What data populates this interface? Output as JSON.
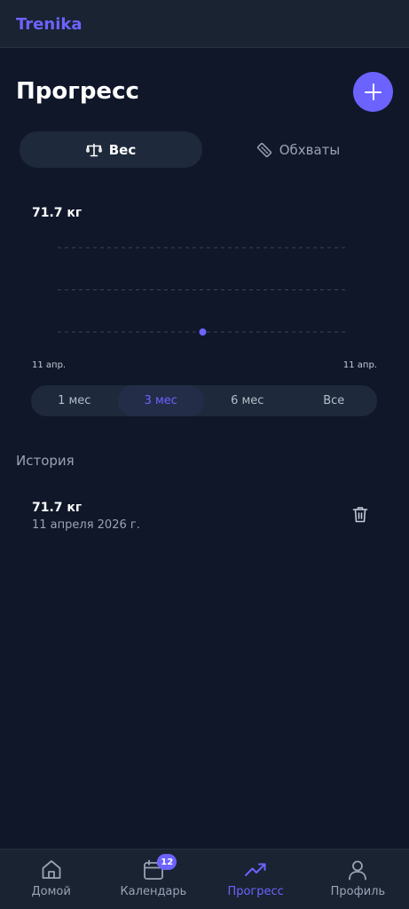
{
  "app": {
    "brand": "Trenika"
  },
  "header": {
    "title": "Прогресс",
    "add_icon": "plus-icon"
  },
  "colors": {
    "accent": "#6c63ff",
    "background": "#0f1729",
    "surface": "#1e293b"
  },
  "tabs": [
    {
      "label": "Вес",
      "icon": "scale-icon",
      "active": true
    },
    {
      "label": "Обхваты",
      "icon": "ruler-icon",
      "active": false
    }
  ],
  "chart_data": {
    "type": "scatter",
    "title": "71.7 кг",
    "x": [
      "11 апр."
    ],
    "values": [
      71.7
    ],
    "x_tick_labels": [
      "11 апр.",
      "11 апр."
    ],
    "grid": true,
    "gridline_count": 3
  },
  "range": {
    "options": [
      "1 мес",
      "3 мес",
      "6 мес",
      "Все"
    ],
    "selected": "3 мес"
  },
  "history": {
    "title": "История",
    "entries": [
      {
        "value": "71.7 кг",
        "date": "11 апреля 2026 г.",
        "delete_icon": "trash-icon"
      }
    ]
  },
  "nav": {
    "items": [
      {
        "label": "Домой",
        "icon": "home-icon",
        "active": false
      },
      {
        "label": "Календарь",
        "icon": "calendar-icon",
        "active": false,
        "badge": "12"
      },
      {
        "label": "Прогресс",
        "icon": "trending-up-icon",
        "active": true
      },
      {
        "label": "Профиль",
        "icon": "user-icon",
        "active": false
      }
    ]
  }
}
